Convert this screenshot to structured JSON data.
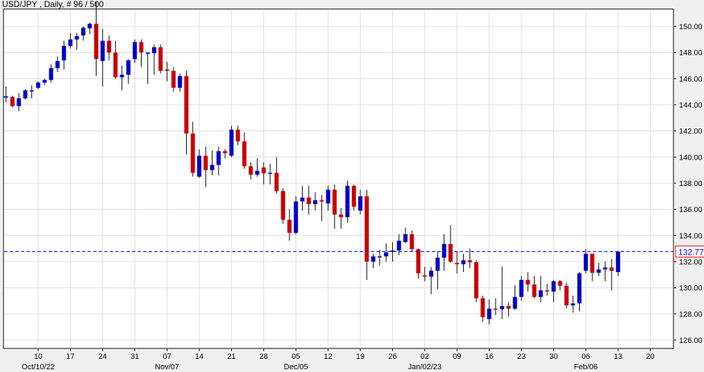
{
  "header": {
    "title": "USD/JPY , Daily, # 96 / 500"
  },
  "colors": {
    "up": "#0000c8",
    "down": "#c80000",
    "grid": "#dcdcdc",
    "current_line": "#0000ff",
    "current_box": "#ff0000"
  },
  "chart_data": {
    "type": "candlestick",
    "title": "USD/JPY , Daily, # 96 / 500",
    "ylim": [
      125.5,
      151.3
    ],
    "y_ticks": [
      "126.00",
      "128.00",
      "130.00",
      "132.00",
      "134.00",
      "136.00",
      "138.00",
      "140.00",
      "142.00",
      "144.00",
      "146.00",
      "148.00",
      "150.00"
    ],
    "x_ticks": [
      {
        "index": 5,
        "label": "10",
        "month": "Oct/10/22"
      },
      {
        "index": 10,
        "label": "17"
      },
      {
        "index": 15,
        "label": "24"
      },
      {
        "index": 20,
        "label": "31"
      },
      {
        "index": 25,
        "label": "07",
        "month": "Nov/07"
      },
      {
        "index": 30,
        "label": "14"
      },
      {
        "index": 35,
        "label": "21"
      },
      {
        "index": 40,
        "label": "28"
      },
      {
        "index": 45,
        "label": "05",
        "month": "Dec/05"
      },
      {
        "index": 50,
        "label": "12"
      },
      {
        "index": 55,
        "label": "19"
      },
      {
        "index": 60,
        "label": "26"
      },
      {
        "index": 65,
        "label": "02",
        "month": "Jan/02/23"
      },
      {
        "index": 70,
        "label": "09"
      },
      {
        "index": 75,
        "label": "16"
      },
      {
        "index": 80,
        "label": "23"
      },
      {
        "index": 85,
        "label": "30"
      },
      {
        "index": 90,
        "label": "06",
        "month": "Feb/06"
      },
      {
        "index": 95,
        "label": "13"
      },
      {
        "index": 100,
        "label": "20"
      }
    ],
    "current_price": "132.77",
    "ohlc": [
      [
        144.55,
        145.4,
        144.2,
        144.65
      ],
      [
        144.6,
        144.7,
        143.8,
        143.9
      ],
      [
        143.9,
        144.9,
        143.5,
        144.5
      ],
      [
        144.5,
        145.2,
        144.4,
        145.1
      ],
      [
        145.1,
        145.5,
        144.5,
        145.1
      ],
      [
        145.3,
        145.8,
        145.2,
        145.7
      ],
      [
        145.7,
        146.0,
        145.5,
        145.9
      ],
      [
        145.9,
        147.1,
        145.7,
        146.8
      ],
      [
        146.8,
        147.7,
        146.5,
        147.35
      ],
      [
        147.4,
        148.9,
        146.7,
        148.5
      ],
      [
        148.5,
        149.5,
        148.3,
        149.0
      ],
      [
        149.0,
        149.5,
        148.2,
        149.25
      ],
      [
        149.3,
        150.0,
        148.9,
        149.9
      ],
      [
        149.85,
        150.3,
        149.4,
        150.2
      ],
      [
        150.2,
        151.9,
        146.2,
        147.5
      ],
      [
        147.35,
        149.8,
        145.4,
        148.9
      ],
      [
        148.9,
        149.3,
        147.4,
        148.0
      ],
      [
        148.0,
        148.9,
        146.0,
        146.1
      ],
      [
        146.1,
        147.0,
        145.1,
        146.3
      ],
      [
        146.3,
        147.5,
        145.6,
        147.4
      ],
      [
        147.5,
        149.0,
        147.2,
        148.8
      ],
      [
        148.8,
        149.0,
        146.9,
        148.0
      ],
      [
        147.9,
        148.0,
        145.6,
        148.0
      ],
      [
        147.95,
        148.6,
        146.3,
        148.4
      ],
      [
        148.4,
        148.6,
        146.4,
        146.6
      ],
      [
        146.7,
        147.3,
        145.8,
        146.6
      ],
      [
        146.6,
        146.9,
        145.0,
        145.3
      ],
      [
        145.3,
        146.4,
        145.0,
        146.2
      ],
      [
        146.2,
        146.6,
        140.2,
        141.8
      ],
      [
        141.8,
        142.7,
        138.5,
        138.8
      ],
      [
        138.5,
        140.6,
        138.4,
        140.1
      ],
      [
        140.1,
        140.8,
        137.7,
        139.0
      ],
      [
        139.0,
        140.5,
        138.6,
        139.4
      ],
      [
        139.4,
        140.8,
        138.6,
        140.45
      ],
      [
        140.45,
        140.6,
        139.9,
        140.3
      ],
      [
        140.1,
        142.4,
        140.0,
        142.1
      ],
      [
        142.1,
        142.4,
        140.9,
        141.2
      ],
      [
        141.2,
        141.9,
        139.1,
        139.3
      ],
      [
        139.3,
        139.6,
        138.3,
        138.65
      ],
      [
        138.65,
        139.9,
        138.5,
        138.95
      ],
      [
        139.2,
        139.6,
        137.9,
        138.75
      ],
      [
        138.8,
        139.5,
        137.9,
        138.8
      ],
      [
        138.8,
        140.0,
        137.2,
        137.4
      ],
      [
        137.4,
        137.6,
        134.9,
        135.2
      ],
      [
        135.2,
        136.0,
        133.6,
        134.2
      ],
      [
        134.2,
        137.0,
        134.1,
        136.6
      ],
      [
        136.6,
        137.8,
        135.9,
        136.9
      ],
      [
        136.9,
        137.8,
        135.6,
        136.4
      ],
      [
        136.4,
        137.3,
        135.9,
        136.7
      ],
      [
        136.7,
        137.1,
        135.1,
        136.6
      ],
      [
        136.45,
        137.8,
        135.9,
        137.5
      ],
      [
        137.5,
        137.9,
        134.5,
        135.6
      ],
      [
        135.6,
        136.1,
        134.5,
        135.4
      ],
      [
        135.4,
        138.2,
        135.0,
        137.8
      ],
      [
        137.8,
        137.9,
        135.9,
        136.2
      ],
      [
        135.9,
        137.5,
        135.6,
        137.0
      ],
      [
        137.0,
        137.5,
        130.6,
        132.0
      ],
      [
        132.0,
        132.6,
        131.5,
        132.4
      ],
      [
        132.4,
        132.9,
        131.7,
        132.4
      ],
      [
        132.4,
        133.4,
        132.0,
        132.7
      ],
      [
        132.75,
        133.5,
        132.0,
        132.85
      ],
      [
        132.85,
        134.1,
        132.5,
        133.6
      ],
      [
        133.5,
        134.6,
        133.4,
        134.1
      ],
      [
        134.1,
        134.4,
        132.8,
        132.95
      ],
      [
        132.95,
        133.0,
        130.7,
        131.1
      ],
      [
        130.95,
        131.6,
        130.5,
        130.85
      ],
      [
        130.85,
        131.6,
        129.5,
        131.3
      ],
      [
        131.3,
        132.8,
        129.9,
        132.3
      ],
      [
        132.3,
        134.1,
        131.3,
        133.35
      ],
      [
        133.35,
        134.8,
        131.9,
        132.0
      ],
      [
        131.9,
        132.8,
        131.1,
        131.8
      ],
      [
        131.8,
        132.6,
        131.2,
        132.1
      ],
      [
        132.1,
        133.0,
        131.5,
        131.95
      ],
      [
        131.95,
        132.1,
        128.9,
        129.2
      ],
      [
        129.2,
        129.4,
        127.4,
        127.75
      ],
      [
        127.6,
        129.1,
        127.2,
        128.4
      ],
      [
        128.4,
        129.2,
        127.9,
        128.35
      ],
      [
        128.35,
        131.6,
        127.6,
        128.6
      ],
      [
        128.6,
        128.9,
        127.8,
        128.4
      ],
      [
        128.4,
        130.2,
        128.3,
        129.3
      ],
      [
        129.3,
        130.9,
        129.0,
        130.6
      ],
      [
        130.6,
        131.2,
        129.7,
        130.25
      ],
      [
        130.25,
        130.9,
        129.2,
        129.3
      ],
      [
        129.3,
        130.9,
        128.9,
        129.8
      ],
      [
        129.8,
        130.3,
        129.4,
        129.75
      ],
      [
        129.7,
        130.6,
        128.9,
        130.5
      ],
      [
        130.5,
        130.6,
        129.8,
        130.15
      ],
      [
        130.15,
        130.4,
        128.4,
        128.65
      ],
      [
        128.65,
        129.4,
        128.1,
        128.8
      ],
      [
        128.8,
        131.2,
        128.2,
        131.1
      ],
      [
        131.3,
        132.95,
        131.1,
        132.6
      ],
      [
        132.6,
        132.6,
        130.5,
        131.15
      ],
      [
        131.15,
        131.9,
        130.9,
        131.4
      ],
      [
        131.4,
        132.0,
        130.5,
        131.55
      ],
      [
        131.55,
        132.2,
        129.8,
        131.3
      ],
      [
        131.2,
        132.8,
        130.9,
        132.77
      ]
    ]
  }
}
